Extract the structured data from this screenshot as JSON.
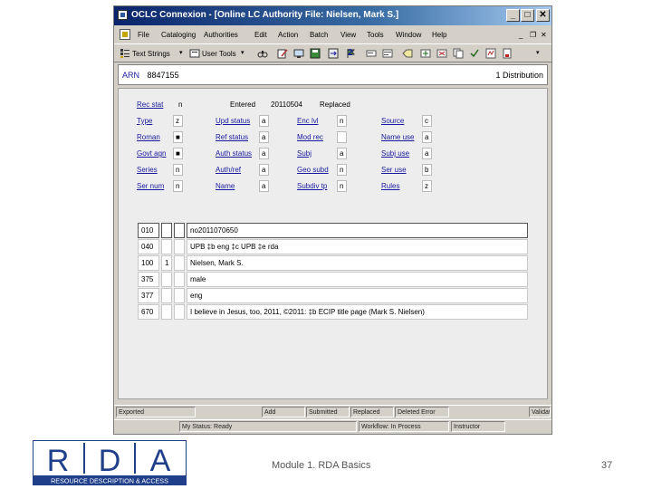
{
  "window": {
    "title": "OCLC Connexion - [Online LC Authority File: Nielsen, Mark S.]",
    "controls": {
      "minimize": "_",
      "maximize": "□",
      "close": "✕"
    }
  },
  "menu": {
    "items": [
      "File",
      "Cataloging",
      "Authorities",
      "Edit",
      "Action",
      "Batch",
      "View",
      "Tools",
      "Window",
      "Help"
    ],
    "mdi_controls": {
      "minimize": "_",
      "restore": "❐",
      "close": "✕"
    }
  },
  "toolbar": {
    "text_strings_label": "Text Strings",
    "user_tools_label": "User Tools",
    "dropdown_glyph": "▾",
    "icons": [
      "binoculars-icon",
      "edit-icon",
      "display-icon",
      "save-icon",
      "replace-icon",
      "back-icon",
      "forward-icon",
      "number-2-icon",
      "label-icon",
      "ldr-icon",
      "tag-icon",
      "insert-icon",
      "delete-icon",
      "copy-icon",
      "validate-icon",
      "workflow-icon"
    ],
    "number_badge": "2"
  },
  "record": {
    "arn_label": "ARN",
    "arn_value": "8847155",
    "distribution": "1 Distribution"
  },
  "fixed_fields": {
    "rec_stat_label": "Rec stat",
    "rec_stat_value": "n",
    "entered_label": "Entered",
    "entered_value": "20110504",
    "replaced_label": "Replaced",
    "rows": [
      [
        {
          "l": "Type",
          "v": "z"
        },
        {
          "l": "Upd status",
          "v": "a"
        },
        {
          "l": "Enc lvl",
          "v": "n"
        },
        {
          "l": "Source",
          "v": "c"
        }
      ],
      [
        {
          "l": "Roman",
          "v": "■"
        },
        {
          "l": "Ref status",
          "v": "a"
        },
        {
          "l": "Mod rec",
          "v": ""
        },
        {
          "l": "Name use",
          "v": "a"
        }
      ],
      [
        {
          "l": "Govt agn",
          "v": "■"
        },
        {
          "l": "Auth status",
          "v": "a"
        },
        {
          "l": "Subj",
          "v": "a"
        },
        {
          "l": "Subj use",
          "v": "a"
        }
      ],
      [
        {
          "l": "Series",
          "v": "n"
        },
        {
          "l": "Auth/ref",
          "v": "a"
        },
        {
          "l": "Geo subd",
          "v": "n"
        },
        {
          "l": "Ser use",
          "v": "b"
        }
      ],
      [
        {
          "l": "Ser num",
          "v": "n"
        },
        {
          "l": "Name",
          "v": "a"
        },
        {
          "l": "Subdiv tp",
          "v": "n"
        },
        {
          "l": "Rules",
          "v": "z"
        }
      ]
    ]
  },
  "variable_fields": [
    {
      "tag": "010",
      "ind1": "",
      "ind2": "",
      "data": "no2011070650"
    },
    {
      "tag": "040",
      "ind1": "",
      "ind2": "",
      "data": "UPB ‡b eng ‡c UPB ‡e rda"
    },
    {
      "tag": "100",
      "ind1": "1",
      "ind2": "",
      "data": "Nielsen, Mark S."
    },
    {
      "tag": "375",
      "ind1": "",
      "ind2": "",
      "data": "male"
    },
    {
      "tag": "377",
      "ind1": "",
      "ind2": "",
      "data": "eng"
    },
    {
      "tag": "670",
      "ind1": "",
      "ind2": "",
      "data": "I believe in Jesus, too, 2011, ©2011: ‡b ECIP title page (Mark S. Nielsen)"
    }
  ],
  "status_bar": {
    "row1": [
      "Exported",
      "Add",
      "Submitted",
      "Replaced",
      "Deleted Error",
      "Validated"
    ],
    "row2": [
      "My Status: Ready",
      "Workflow: In Process",
      "Instructor"
    ]
  },
  "slide": {
    "logo_letters": [
      "R",
      "D",
      "A"
    ],
    "logo_tagline": "RESOURCE DESCRIPTION & ACCESS",
    "footer": "Module 1. RDA Basics",
    "page_number": "37"
  },
  "colors": {
    "title_start": "#0a246a",
    "title_end": "#a6caf0",
    "link": "#1a1aa0",
    "logo_blue": "#1f3f8a"
  }
}
